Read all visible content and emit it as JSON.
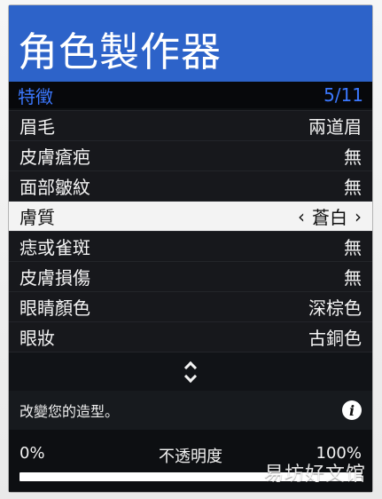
{
  "window": {
    "title": "角色製作器"
  },
  "section": {
    "title": "特徵",
    "count": "5/11"
  },
  "features": [
    {
      "label": "眉毛",
      "value": "兩道眉"
    },
    {
      "label": "皮膚瘡疤",
      "value": "無"
    },
    {
      "label": "面部皺紋",
      "value": "無"
    },
    {
      "label": "膚質",
      "value": "蒼白",
      "left_arrow": "‹",
      "right_arrow": "›"
    },
    {
      "label": "痣或雀斑",
      "value": "無"
    },
    {
      "label": "皮膚損傷",
      "value": "無"
    },
    {
      "label": "眼睛顏色",
      "value": "深棕色"
    },
    {
      "label": "眼妝",
      "value": "古銅色"
    }
  ],
  "navigation": {
    "icon": "updown-arrows-icon"
  },
  "help": {
    "text": "改變您的造型。",
    "icon": "info-icon",
    "icon_glyph": "i"
  },
  "opacity": {
    "title": "不透明度",
    "min_label": "0%",
    "max_label": "100%"
  },
  "watermark": {
    "text": "易坊好文馆"
  },
  "colors": {
    "title_bar": "#2d63c9",
    "section_text": "#3b78ff",
    "panel": "#0f1114",
    "selected_row": "#f3f3f3"
  }
}
